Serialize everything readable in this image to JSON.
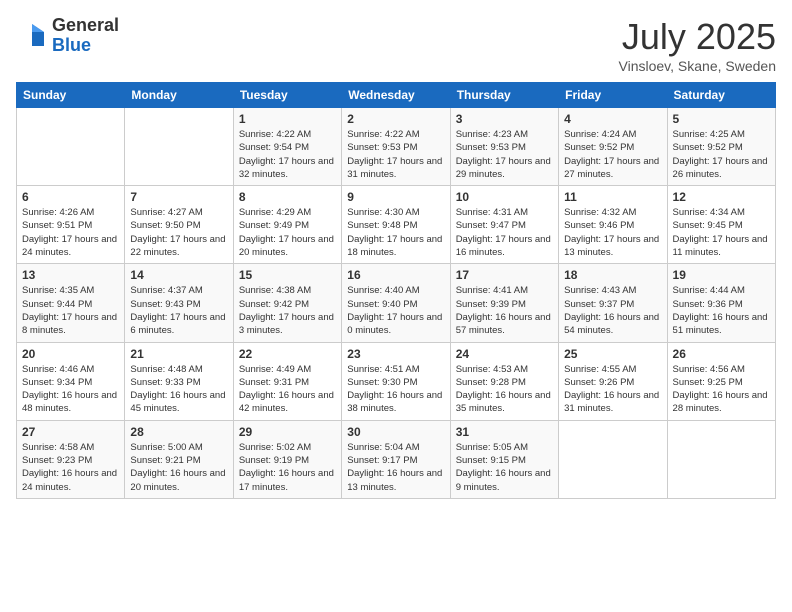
{
  "logo": {
    "general": "General",
    "blue": "Blue"
  },
  "title": "July 2025",
  "subtitle": "Vinsloev, Skane, Sweden",
  "days_of_week": [
    "Sunday",
    "Monday",
    "Tuesday",
    "Wednesday",
    "Thursday",
    "Friday",
    "Saturday"
  ],
  "weeks": [
    [
      {
        "day": "",
        "sunrise": "",
        "sunset": "",
        "daylight": ""
      },
      {
        "day": "",
        "sunrise": "",
        "sunset": "",
        "daylight": ""
      },
      {
        "day": "1",
        "sunrise": "Sunrise: 4:22 AM",
        "sunset": "Sunset: 9:54 PM",
        "daylight": "Daylight: 17 hours and 32 minutes."
      },
      {
        "day": "2",
        "sunrise": "Sunrise: 4:22 AM",
        "sunset": "Sunset: 9:53 PM",
        "daylight": "Daylight: 17 hours and 31 minutes."
      },
      {
        "day": "3",
        "sunrise": "Sunrise: 4:23 AM",
        "sunset": "Sunset: 9:53 PM",
        "daylight": "Daylight: 17 hours and 29 minutes."
      },
      {
        "day": "4",
        "sunrise": "Sunrise: 4:24 AM",
        "sunset": "Sunset: 9:52 PM",
        "daylight": "Daylight: 17 hours and 27 minutes."
      },
      {
        "day": "5",
        "sunrise": "Sunrise: 4:25 AM",
        "sunset": "Sunset: 9:52 PM",
        "daylight": "Daylight: 17 hours and 26 minutes."
      }
    ],
    [
      {
        "day": "6",
        "sunrise": "Sunrise: 4:26 AM",
        "sunset": "Sunset: 9:51 PM",
        "daylight": "Daylight: 17 hours and 24 minutes."
      },
      {
        "day": "7",
        "sunrise": "Sunrise: 4:27 AM",
        "sunset": "Sunset: 9:50 PM",
        "daylight": "Daylight: 17 hours and 22 minutes."
      },
      {
        "day": "8",
        "sunrise": "Sunrise: 4:29 AM",
        "sunset": "Sunset: 9:49 PM",
        "daylight": "Daylight: 17 hours and 20 minutes."
      },
      {
        "day": "9",
        "sunrise": "Sunrise: 4:30 AM",
        "sunset": "Sunset: 9:48 PM",
        "daylight": "Daylight: 17 hours and 18 minutes."
      },
      {
        "day": "10",
        "sunrise": "Sunrise: 4:31 AM",
        "sunset": "Sunset: 9:47 PM",
        "daylight": "Daylight: 17 hours and 16 minutes."
      },
      {
        "day": "11",
        "sunrise": "Sunrise: 4:32 AM",
        "sunset": "Sunset: 9:46 PM",
        "daylight": "Daylight: 17 hours and 13 minutes."
      },
      {
        "day": "12",
        "sunrise": "Sunrise: 4:34 AM",
        "sunset": "Sunset: 9:45 PM",
        "daylight": "Daylight: 17 hours and 11 minutes."
      }
    ],
    [
      {
        "day": "13",
        "sunrise": "Sunrise: 4:35 AM",
        "sunset": "Sunset: 9:44 PM",
        "daylight": "Daylight: 17 hours and 8 minutes."
      },
      {
        "day": "14",
        "sunrise": "Sunrise: 4:37 AM",
        "sunset": "Sunset: 9:43 PM",
        "daylight": "Daylight: 17 hours and 6 minutes."
      },
      {
        "day": "15",
        "sunrise": "Sunrise: 4:38 AM",
        "sunset": "Sunset: 9:42 PM",
        "daylight": "Daylight: 17 hours and 3 minutes."
      },
      {
        "day": "16",
        "sunrise": "Sunrise: 4:40 AM",
        "sunset": "Sunset: 9:40 PM",
        "daylight": "Daylight: 17 hours and 0 minutes."
      },
      {
        "day": "17",
        "sunrise": "Sunrise: 4:41 AM",
        "sunset": "Sunset: 9:39 PM",
        "daylight": "Daylight: 16 hours and 57 minutes."
      },
      {
        "day": "18",
        "sunrise": "Sunrise: 4:43 AM",
        "sunset": "Sunset: 9:37 PM",
        "daylight": "Daylight: 16 hours and 54 minutes."
      },
      {
        "day": "19",
        "sunrise": "Sunrise: 4:44 AM",
        "sunset": "Sunset: 9:36 PM",
        "daylight": "Daylight: 16 hours and 51 minutes."
      }
    ],
    [
      {
        "day": "20",
        "sunrise": "Sunrise: 4:46 AM",
        "sunset": "Sunset: 9:34 PM",
        "daylight": "Daylight: 16 hours and 48 minutes."
      },
      {
        "day": "21",
        "sunrise": "Sunrise: 4:48 AM",
        "sunset": "Sunset: 9:33 PM",
        "daylight": "Daylight: 16 hours and 45 minutes."
      },
      {
        "day": "22",
        "sunrise": "Sunrise: 4:49 AM",
        "sunset": "Sunset: 9:31 PM",
        "daylight": "Daylight: 16 hours and 42 minutes."
      },
      {
        "day": "23",
        "sunrise": "Sunrise: 4:51 AM",
        "sunset": "Sunset: 9:30 PM",
        "daylight": "Daylight: 16 hours and 38 minutes."
      },
      {
        "day": "24",
        "sunrise": "Sunrise: 4:53 AM",
        "sunset": "Sunset: 9:28 PM",
        "daylight": "Daylight: 16 hours and 35 minutes."
      },
      {
        "day": "25",
        "sunrise": "Sunrise: 4:55 AM",
        "sunset": "Sunset: 9:26 PM",
        "daylight": "Daylight: 16 hours and 31 minutes."
      },
      {
        "day": "26",
        "sunrise": "Sunrise: 4:56 AM",
        "sunset": "Sunset: 9:25 PM",
        "daylight": "Daylight: 16 hours and 28 minutes."
      }
    ],
    [
      {
        "day": "27",
        "sunrise": "Sunrise: 4:58 AM",
        "sunset": "Sunset: 9:23 PM",
        "daylight": "Daylight: 16 hours and 24 minutes."
      },
      {
        "day": "28",
        "sunrise": "Sunrise: 5:00 AM",
        "sunset": "Sunset: 9:21 PM",
        "daylight": "Daylight: 16 hours and 20 minutes."
      },
      {
        "day": "29",
        "sunrise": "Sunrise: 5:02 AM",
        "sunset": "Sunset: 9:19 PM",
        "daylight": "Daylight: 16 hours and 17 minutes."
      },
      {
        "day": "30",
        "sunrise": "Sunrise: 5:04 AM",
        "sunset": "Sunset: 9:17 PM",
        "daylight": "Daylight: 16 hours and 13 minutes."
      },
      {
        "day": "31",
        "sunrise": "Sunrise: 5:05 AM",
        "sunset": "Sunset: 9:15 PM",
        "daylight": "Daylight: 16 hours and 9 minutes."
      },
      {
        "day": "",
        "sunrise": "",
        "sunset": "",
        "daylight": ""
      },
      {
        "day": "",
        "sunrise": "",
        "sunset": "",
        "daylight": ""
      }
    ]
  ]
}
